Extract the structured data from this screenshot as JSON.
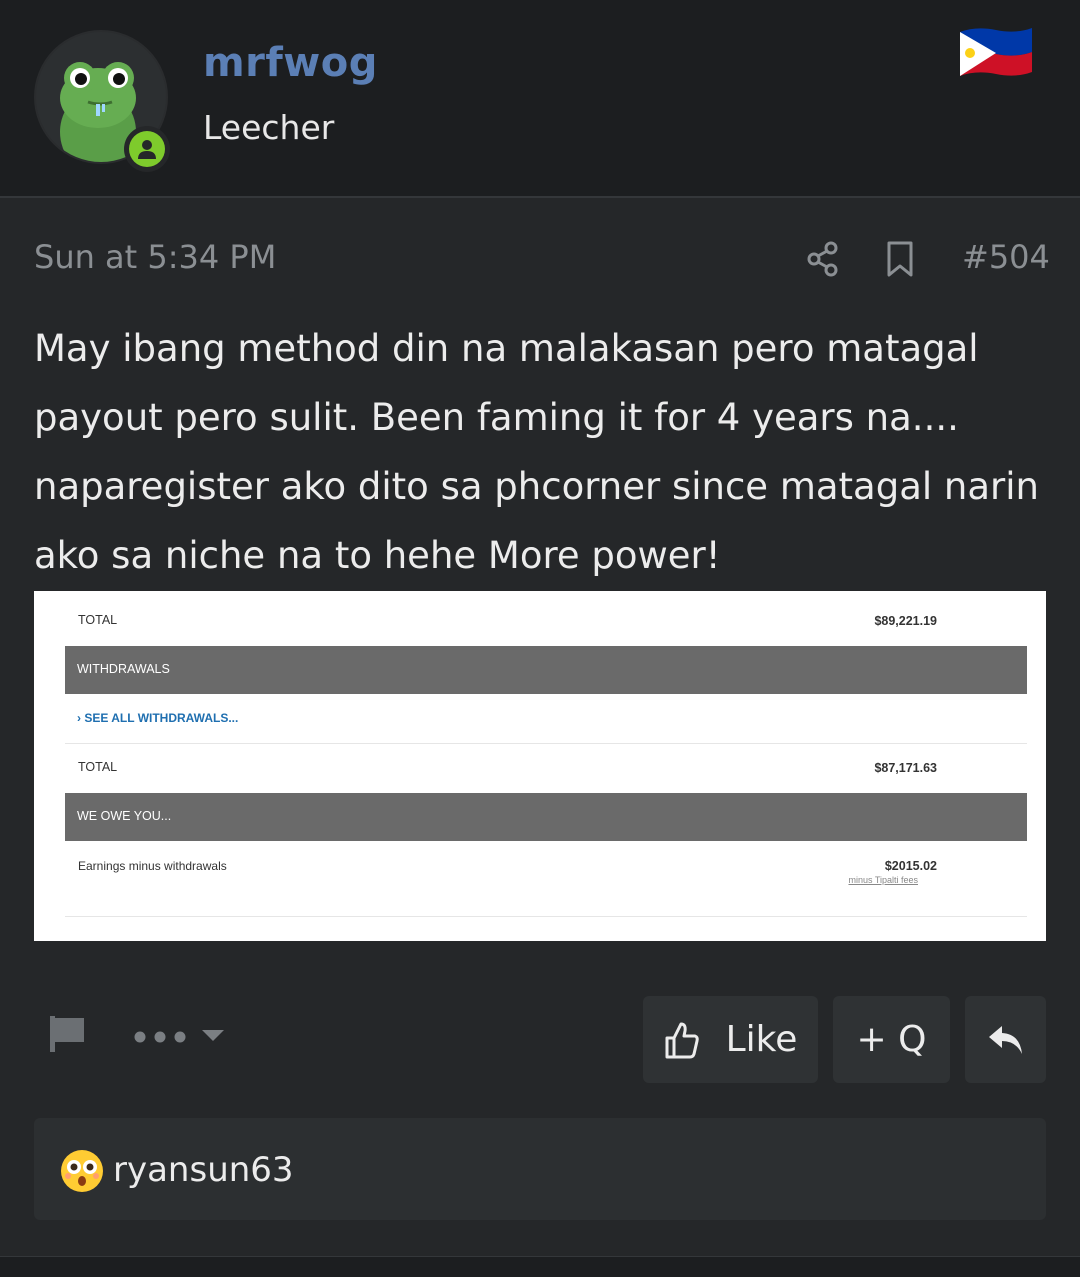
{
  "user": {
    "name": "mrfwog",
    "title": "Leecher",
    "flag": "philippines-flag-icon",
    "status": "online"
  },
  "post": {
    "date": "Sun at 5:34 PM",
    "number": "#504",
    "lines": [
      "May ibang method din na malakasan pero matagal",
      "payout pero sulit. Been faming it for 4 years na....",
      "naparegister ako dito sa phcorner since matagal narin",
      "ako sa niche na to hehe More power!"
    ]
  },
  "attachment": {
    "total1_label": "TOTAL",
    "total1_value": "$89,221.19",
    "withdrawals_header": "WITHDRAWALS",
    "see_all": "SEE ALL WITHDRAWALS...",
    "total2_label": "TOTAL",
    "total2_value": "$87,171.63",
    "owe_header": "WE OWE YOU...",
    "earnings_label": "Earnings minus withdrawals",
    "earnings_value": "$2015.02",
    "fees_note": "minus Tipalti fees"
  },
  "actions": {
    "like_label": "Like",
    "quote_label": "+ Q"
  },
  "reactions": {
    "emoji": "flushed-face-icon",
    "user": "ryansun63"
  },
  "colors": {
    "background": "#252729",
    "header": "#1c1e20",
    "username": "#5b7fb5",
    "online": "#7ecb2c",
    "button": "#2f3234",
    "link": "#1f6fb0"
  }
}
